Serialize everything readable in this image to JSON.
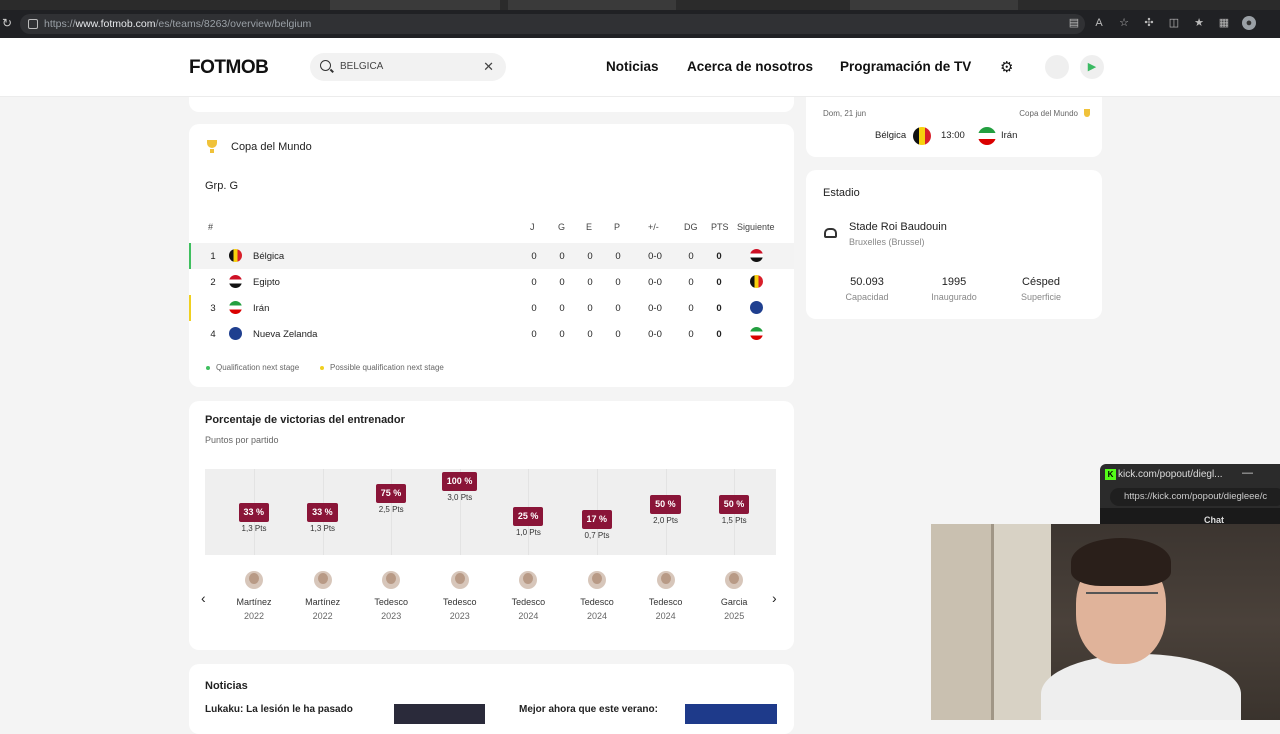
{
  "browser": {
    "url_prefix": "https://",
    "url_host": "www.fotmob.com",
    "url_path": "/es/teams/8263/overview/belgium"
  },
  "header": {
    "logo": "FOTMOB",
    "search_value": "BELGICA",
    "nav": [
      "Noticias",
      "Acerca de nosotros",
      "Programación de TV"
    ]
  },
  "world_cup": {
    "title": "Copa del Mundo",
    "group": "Grp. G",
    "columns": [
      "#",
      "J",
      "G",
      "E",
      "P",
      "+/-",
      "DG",
      "PTS",
      "Siguiente"
    ],
    "rows": [
      {
        "pos": "1",
        "team": "Bélgica",
        "j": "0",
        "g": "0",
        "e": "0",
        "p": "0",
        "gd": "0-0",
        "dg": "0",
        "pts": "0"
      },
      {
        "pos": "2",
        "team": "Egipto",
        "j": "0",
        "g": "0",
        "e": "0",
        "p": "0",
        "gd": "0-0",
        "dg": "0",
        "pts": "0"
      },
      {
        "pos": "3",
        "team": "Irán",
        "j": "0",
        "g": "0",
        "e": "0",
        "p": "0",
        "gd": "0-0",
        "dg": "0",
        "pts": "0"
      },
      {
        "pos": "4",
        "team": "Nueva Zelanda",
        "j": "0",
        "g": "0",
        "e": "0",
        "p": "0",
        "gd": "0-0",
        "dg": "0",
        "pts": "0"
      }
    ],
    "legend": [
      "Qualification next stage",
      "Possible qualification next stage"
    ],
    "colors": {
      "qualify": "#3fbf5f",
      "possible": "#f0d020"
    }
  },
  "coach": {
    "title": "Porcentaje de victorias del entrenador",
    "subtitle": "Puntos por partido",
    "bars": [
      {
        "pct": "33 %",
        "pts": "1,3 Pts",
        "name": "Martínez",
        "year": "2022"
      },
      {
        "pct": "33 %",
        "pts": "1,3 Pts",
        "name": "Martínez",
        "year": "2022"
      },
      {
        "pct": "75 %",
        "pts": "2,5 Pts",
        "name": "Tedesco",
        "year": "2023"
      },
      {
        "pct": "100 %",
        "pts": "3,0 Pts",
        "name": "Tedesco",
        "year": "2023"
      },
      {
        "pct": "25 %",
        "pts": "1,0 Pts",
        "name": "Tedesco",
        "year": "2024"
      },
      {
        "pct": "17 %",
        "pts": "0,7 Pts",
        "name": "Tedesco",
        "year": "2024"
      },
      {
        "pct": "50 %",
        "pts": "2,0 Pts",
        "name": "Tedesco",
        "year": "2024"
      },
      {
        "pct": "50 %",
        "pts": "1,5 Pts",
        "name": "Garcia",
        "year": "2025"
      }
    ],
    "prev": "‹",
    "next": "›",
    "badge_color": "#8a1538"
  },
  "news": {
    "title": "Noticias",
    "items": [
      "Lukaku: La lesión le ha pasado",
      "Mejor ahora que este verano:"
    ]
  },
  "next_match": {
    "date": "Dom, 21 jun",
    "competition": "Copa del Mundo",
    "home": "Bélgica",
    "time": "13:00",
    "away": "Irán"
  },
  "stadium": {
    "title": "Estadio",
    "name": "Stade Roi Baudouin",
    "city": "Bruxelles (Brussel)",
    "stats": [
      {
        "value": "50.093",
        "label": "Capacidad"
      },
      {
        "value": "1995",
        "label": "Inaugurado"
      },
      {
        "value": "Césped",
        "label": "Superficie"
      }
    ]
  },
  "kick": {
    "title": "kick.com/popout/diegl...",
    "url": "https://kick.com/popout/diegleee/c",
    "chat": "Chat"
  }
}
